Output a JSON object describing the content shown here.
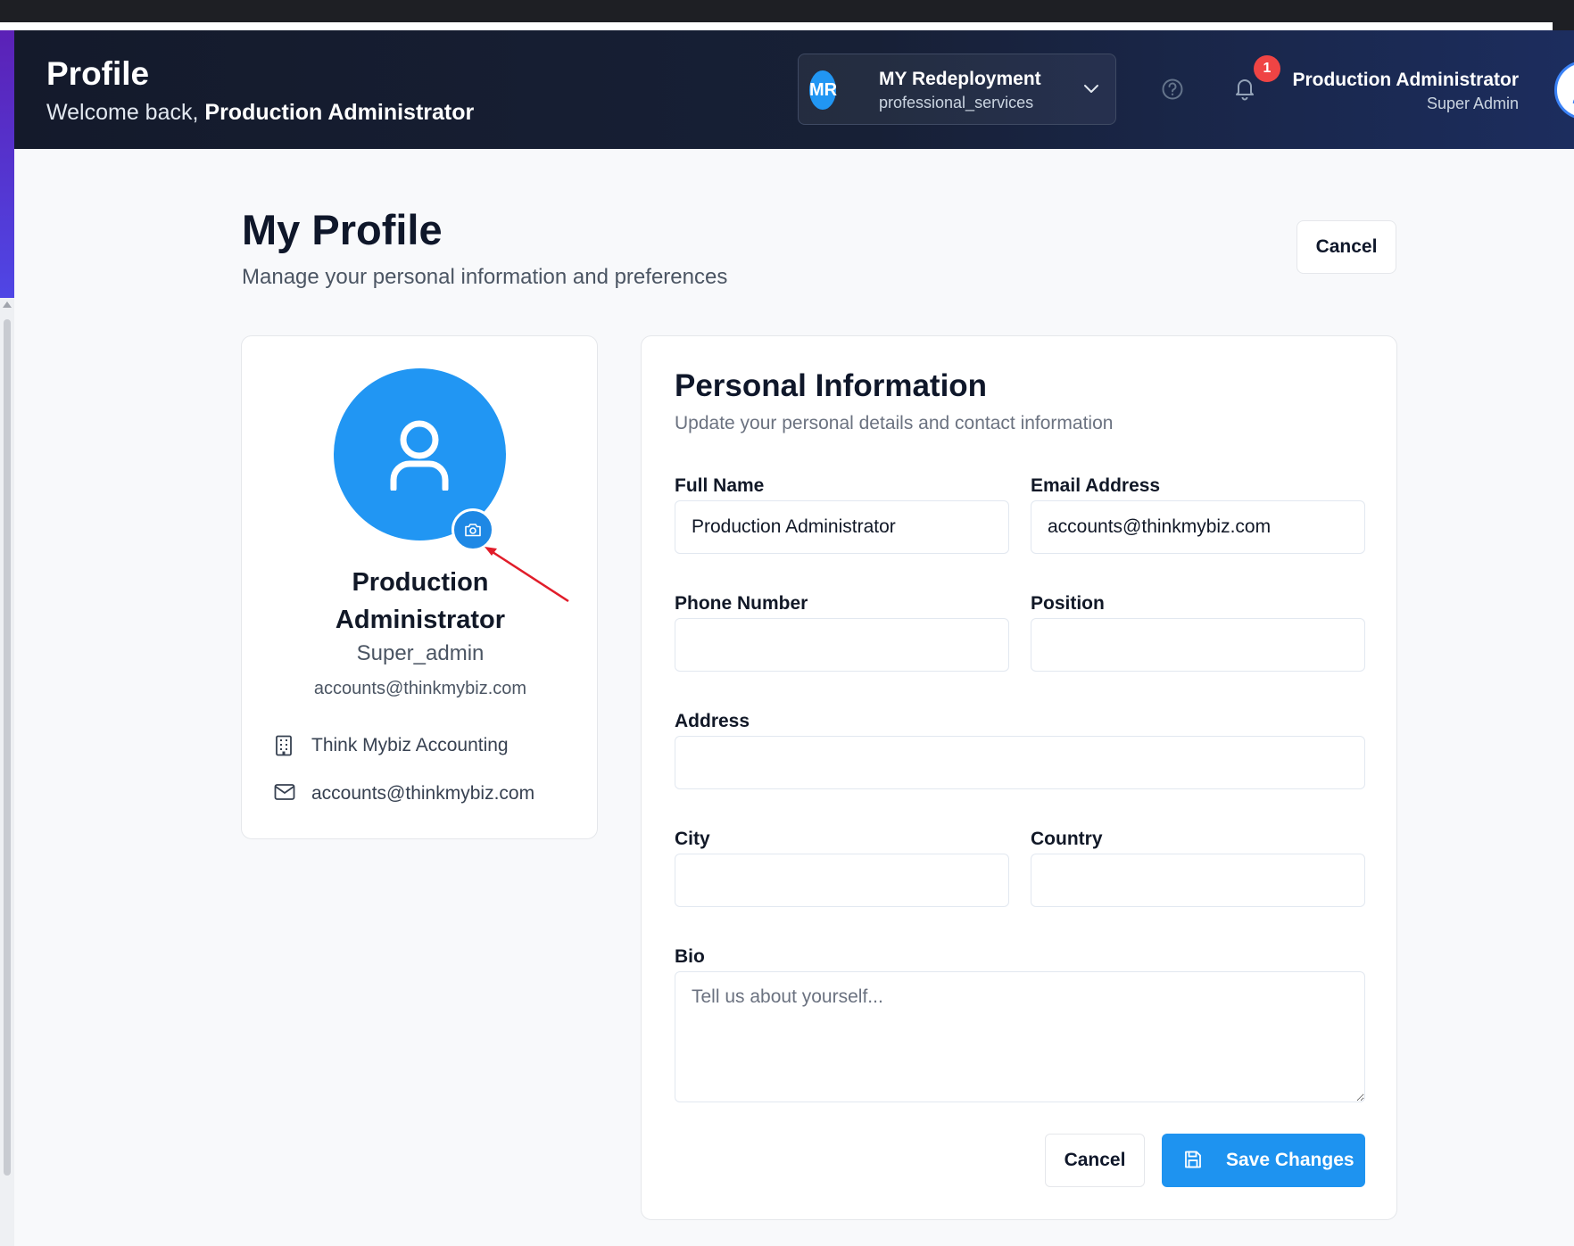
{
  "header": {
    "title": "Profile",
    "welcome_prefix": "Welcome back, ",
    "welcome_name": "Production Administrator",
    "org": {
      "initials": "MR",
      "name": "MY Redeployment",
      "type": "professional_services"
    },
    "notification_count": "1",
    "user": {
      "name": "Production Administrator",
      "role": "Super Admin"
    }
  },
  "page": {
    "title": "My Profile",
    "subtitle": "Manage your personal information and preferences",
    "cancel_label": "Cancel"
  },
  "profile_card": {
    "name_line1": "Production",
    "name_line2": "Administrator",
    "role": "Super_admin",
    "email": "accounts@thinkmybiz.com",
    "company": "Think Mybiz Accounting",
    "contact_email": "accounts@thinkmybiz.com"
  },
  "form": {
    "title": "Personal Information",
    "subtitle": "Update your personal details and contact information",
    "full_name": {
      "label": "Full Name",
      "value": "Production Administrator"
    },
    "email": {
      "label": "Email Address",
      "value": "accounts@thinkmybiz.com"
    },
    "phone": {
      "label": "Phone Number",
      "value": ""
    },
    "position": {
      "label": "Position",
      "value": ""
    },
    "address": {
      "label": "Address",
      "value": ""
    },
    "city": {
      "label": "City",
      "value": ""
    },
    "country": {
      "label": "Country",
      "value": ""
    },
    "bio": {
      "label": "Bio",
      "placeholder": "Tell us about yourself..."
    },
    "cancel_label": "Cancel",
    "save_label": "Save Changes"
  },
  "colors": {
    "accent": "#1e93f0",
    "avatar": "#2196f3",
    "notification": "#ef4444",
    "annotation_arrow": "#e11d2a"
  }
}
